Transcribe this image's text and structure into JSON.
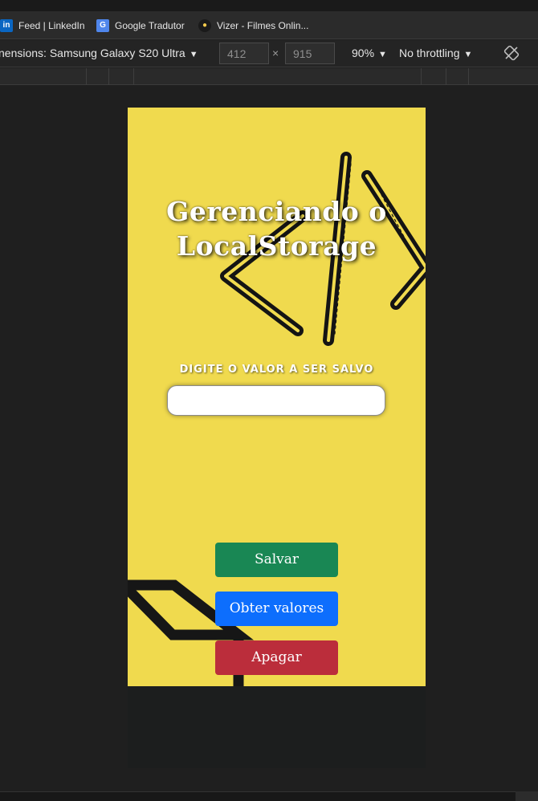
{
  "bookmarks": [
    {
      "label": "Feed | LinkedIn",
      "icon": "linkedin-icon"
    },
    {
      "label": "Google Tradutor",
      "icon": "google-translate-icon"
    },
    {
      "label": "Vizer - Filmes Onlin...",
      "icon": "vizer-icon"
    }
  ],
  "devtools": {
    "dimensions_label": "nensions: Samsung Galaxy S20 Ultra",
    "width": "412",
    "height": "915",
    "times": "×",
    "zoom": "90%",
    "throttling": "No throttling",
    "caret": "▼"
  },
  "app": {
    "title_line1": "Gerenciando o",
    "title_line2": "LocalStorage",
    "input_label": "DIGITE O VALOR A SER SALVO",
    "input_value": "",
    "save_label": "Salvar",
    "get_label": "Obter valores",
    "clear_label": "Apagar",
    "colors": {
      "background": "#f0da4e",
      "save": "#198754",
      "get": "#0d6efd",
      "clear": "#bb2d3b"
    }
  }
}
